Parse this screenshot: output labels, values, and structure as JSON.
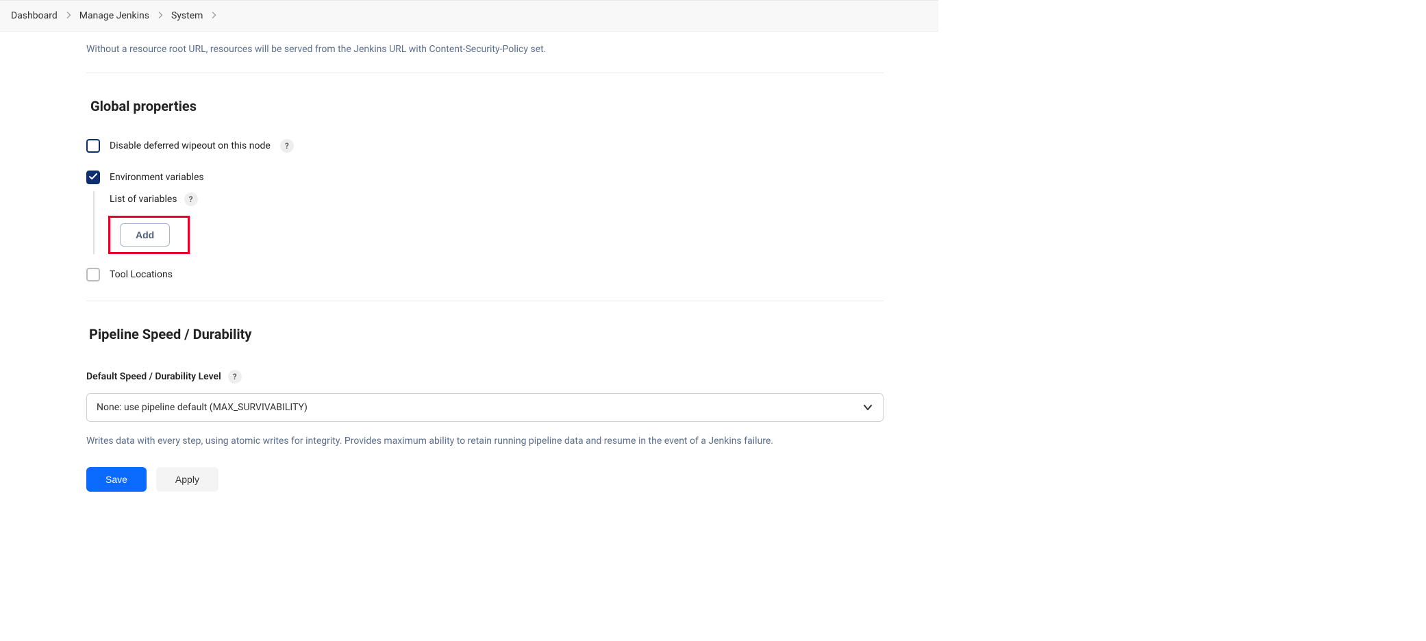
{
  "breadcrumb": {
    "items": [
      "Dashboard",
      "Manage Jenkins",
      "System"
    ]
  },
  "resource_root_desc": "Without a resource root URL, resources will be served from the Jenkins URL with Content-Security-Policy set.",
  "global_properties": {
    "title": "Global properties",
    "disable_wipeout": {
      "label": "Disable deferred wipeout on this node",
      "checked": false
    },
    "env_vars": {
      "label": "Environment variables",
      "checked": true,
      "list_label": "List of variables",
      "add_label": "Add"
    },
    "tool_locations": {
      "label": "Tool Locations",
      "checked": false
    }
  },
  "pipeline": {
    "title": "Pipeline Speed / Durability",
    "field_label": "Default Speed / Durability Level",
    "selected": "None: use pipeline default (MAX_SURVIVABILITY)",
    "help_desc": "Writes data with every step, using atomic writes for integrity.  Provides maximum ability to retain running pipeline data and resume in the event of a Jenkins failure."
  },
  "buttons": {
    "save": "Save",
    "apply": "Apply"
  },
  "help_glyph": "?"
}
